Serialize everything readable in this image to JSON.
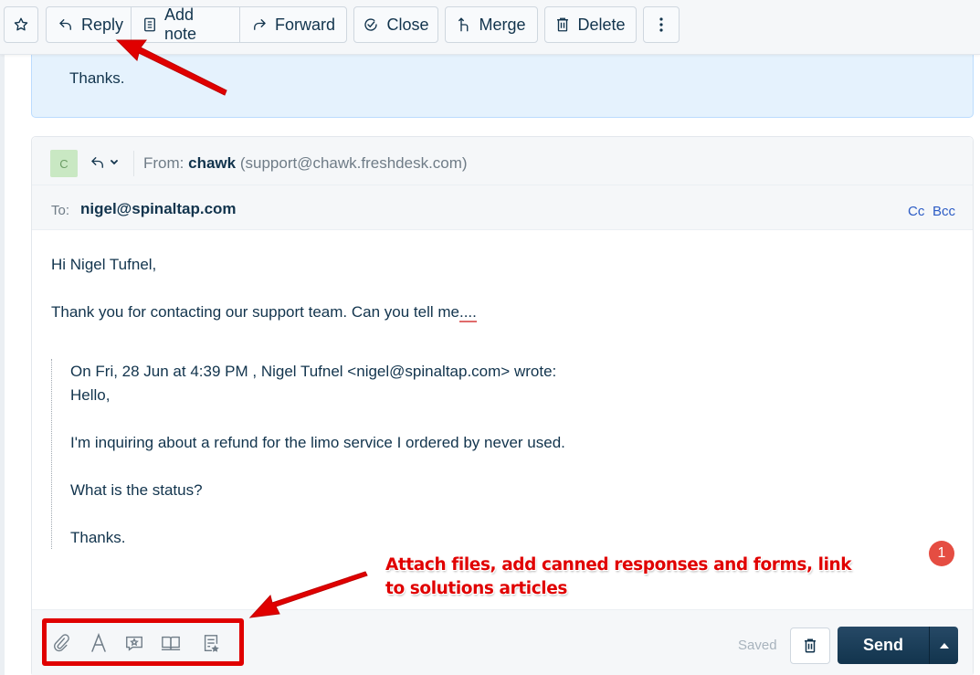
{
  "toolbar": {
    "star_icon": "star-icon",
    "reply_label": "Reply",
    "add_note_label": "Add note",
    "forward_label": "Forward",
    "close_label": "Close",
    "merge_label": "Merge",
    "delete_label": "Delete",
    "more_icon": "vertical-ellipsis-icon"
  },
  "previous_message": {
    "text": "Thanks."
  },
  "reply_editor": {
    "avatar_initial": "C",
    "avatar_color": "#c9e8c3",
    "from_label": "From:",
    "from_name": "chawk",
    "from_email": "(support@chawk.freshdesk.com)",
    "to_label": "To:",
    "to_value": "nigel@spinaltap.com",
    "cc_label": "Cc",
    "bcc_label": "Bcc",
    "body": {
      "greeting": "Hi Nigel Tufnel,",
      "line1_main": "Thank you for contacting our support team.  Can you tell me",
      "line1_tail": "...."
    },
    "quote": {
      "header": "On Fri, 28 Jun at 4:39 PM , Nigel Tufnel <nigel@spinaltap.com> wrote:",
      "lines": [
        "Hello,",
        "I'm inquiring about a refund for the limo service I ordered by never used.",
        "What is the status?",
        "Thanks."
      ]
    },
    "notification_count": "1",
    "footer": {
      "tools": [
        "attach-icon",
        "font-format-icon",
        "canned-response-icon",
        "solutions-article-icon",
        "forms-icon"
      ],
      "saved_label": "Saved",
      "send_label": "Send",
      "send_color": "#12344d"
    }
  },
  "annotations": {
    "callout_text": "Attach files, add canned responses and forms, link to solutions articles",
    "color": "#e00000"
  }
}
